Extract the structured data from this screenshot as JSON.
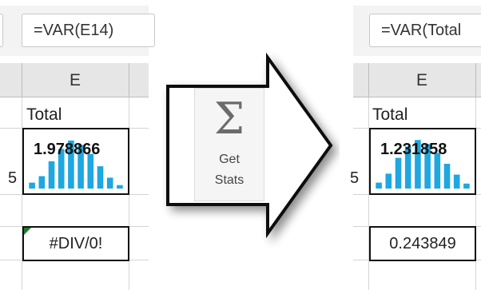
{
  "before": {
    "formula": "=VAR(E14)",
    "column_letter": "E",
    "header_cell": "Total",
    "row_fragment": "5",
    "sparkline_value": "1.978866",
    "result": "#DIV/0!",
    "sparkline_bars": [
      0.12,
      0.25,
      0.55,
      0.8,
      0.97,
      0.88,
      0.7,
      0.45,
      0.22,
      0.07
    ]
  },
  "action": {
    "icon": "sigma-icon",
    "label_line1": "Get",
    "label_line2": "Stats"
  },
  "after": {
    "formula": "=VAR(Total",
    "column_letter": "E",
    "header_cell": "Total",
    "row_fragment": "5",
    "sparkline_value": "1.231858",
    "result": "0.243849",
    "sparkline_bars": [
      0.12,
      0.3,
      0.62,
      0.85,
      0.98,
      0.9,
      0.72,
      0.5,
      0.28,
      0.1
    ]
  },
  "colors": {
    "bar": "#1ea7e1",
    "error_triangle": "#1e7b34"
  }
}
